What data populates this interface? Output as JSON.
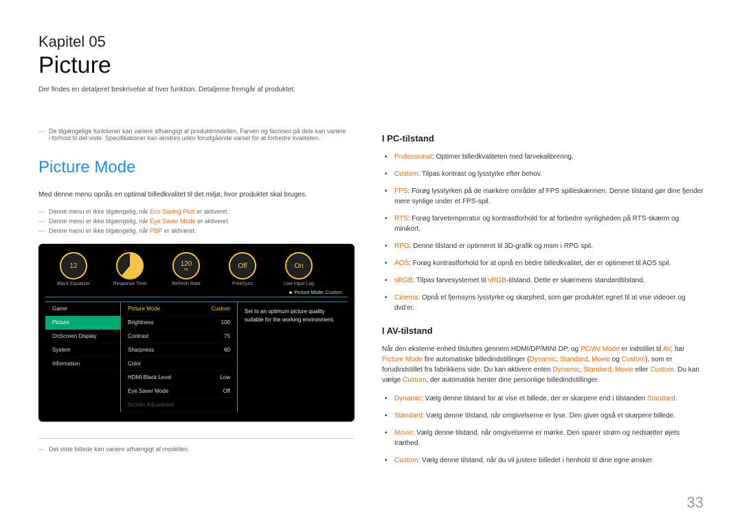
{
  "chapter": "Kapitel 05",
  "title": "Picture",
  "subtitle": "Der findes en detaljeret beskrivelse af hver funktion. Detaljerne fremgår af produktet.",
  "page_number": "33",
  "left": {
    "tip1a": "De tilgængelige funktioner kan variere afhængigt af produktmodellen. Farven og faconen på dele kan variere",
    "tip1b": "i forhold til det viste. Specifikationer kan ændres uden forudgående varsel for at forbedre kvaliteten.",
    "section_heading": "Picture Mode",
    "intro": "Med denne menu opnås en optimal billedkvalitet til det miljø, hvor produktet skal bruges.",
    "tip2_pre": "Denne menu er ikke tilgængelig, når ",
    "tip2_k": "Eco Saving Plus",
    "tip2_post": " er aktiveret.",
    "tip3_pre": "Denne menu er ikke tilgængelig, når ",
    "tip3_k": "Eye Saver Mode",
    "tip3_post": " er aktiveret.",
    "tip4_pre": "Denne menu er ikke tilgængelig, når ",
    "tip4_k": "PBP",
    "tip4_post": " er aktiveret.",
    "footnote": "Det viste billede kan variere afhængigt af modellen."
  },
  "osd": {
    "gauges": [
      {
        "value": "12",
        "sub": "",
        "label": "Black Equalizer"
      },
      {
        "value": "",
        "sub": "",
        "label": "Response Time"
      },
      {
        "value": "120",
        "sub": "Hz",
        "label": "Refresh Rate"
      },
      {
        "value": "Off",
        "sub": "",
        "label": "FreeSync"
      },
      {
        "value": "On",
        "sub": "",
        "label": "Low Input Lag"
      }
    ],
    "mode_label": "Picture Mode:",
    "mode_value": "Custom",
    "nav": [
      "Game",
      "Picture",
      "OnScreen Display",
      "System",
      "Information"
    ],
    "nav_selected": 1,
    "settings": [
      {
        "name": "Picture Mode",
        "value": "Custom",
        "hl": true
      },
      {
        "name": "Brightness",
        "value": "100"
      },
      {
        "name": "Contrast",
        "value": "75"
      },
      {
        "name": "Sharpness",
        "value": "60"
      },
      {
        "name": "Color",
        "value": ""
      },
      {
        "name": "HDMI Black Level",
        "value": "Low"
      },
      {
        "name": "Eye Saver Mode",
        "value": "Off"
      },
      {
        "name": "Screen Adjustment",
        "value": "",
        "dim": true
      }
    ],
    "desc": "Set to an optimum picture quality suitable for the working environment."
  },
  "right": {
    "pc_heading": "I PC-tilstand",
    "pc": [
      {
        "k": "Professional",
        "t": ": Optimer billedkvaliteten med farvekalibrering."
      },
      {
        "k": "Custom",
        "t": ": Tilpas kontrast og lysstyrke efter behov."
      },
      {
        "k": "FPS",
        "t": ": Forøg lysstyrken på de mørkere områder af FPS spilleskærmen. Denne tilstand gør dine fjender mere synlige under et FPS-spil."
      },
      {
        "k": "RTS",
        "t": ": Forøg farvetemperatur og kontrastforhold for at forbedre synligheden på RTS-skærm og minikort."
      },
      {
        "k": "RPG",
        "t": ": Denne tilstand er optimeret til 3D-grafik og msm i RPG spil."
      },
      {
        "k": "AOS",
        "t": ": Forøg kontrastforhold for at opnå en bedre billedkvalitet, der er optimeret til AOS spil."
      },
      {
        "k": "sRGB",
        "t_pre": ": Tilpas farvesystemet til ",
        "k2": "sRGB",
        "t_post": "-tilstand. Dette er skærmens standardtilstand."
      },
      {
        "k": "Cinema",
        "t": ": Opnå et fjernsyns lysstyrke og skarphed, som gør produktet egnet til at vise videoer og dvd'er."
      }
    ],
    "av_heading": "I AV-tilstand",
    "av_para": {
      "p1": "Når den eksterne enhed tilsluttes gennem HDMI/DP/MINI DP, og ",
      "k1": "PC/AV Mode",
      "p2": " er indstillet til ",
      "k2": "AV",
      "p3": ", har ",
      "k3": "Picture Mode",
      "p4": " fire automatiske billedindstillinger (",
      "k4": "Dynamic",
      "c1": ", ",
      "k5": "Standard",
      "c2": ", ",
      "k6": "Movie",
      "p5": " og ",
      "k7": "Custom",
      "p6": "), som er forudindstillet fra fabrikkens side. Du kan aktivere enten ",
      "k8": "Dynamic",
      "c3": ", ",
      "k9": "Standard",
      "c4": ", ",
      "k10": "Movie",
      "p7": " eller ",
      "k11": "Custom",
      "p8": ". Du kan vælge ",
      "k12": "Custom",
      "p9": ", der automatisk henter dine personlige billedindstillinger."
    },
    "av": [
      {
        "k": "Dynamic",
        "t_pre": ": Vælg denne tilstand for at vise et billede, der er skarpere end i tilstanden ",
        "k2": "Standard",
        "t_post": "."
      },
      {
        "k": "Standard",
        "t": ": Vælg denne tilstand, når omgivelserne er lyse. Den giver også et skarpere billede."
      },
      {
        "k": "Movie",
        "t": ": Vælg denne tilstand, når omgivelserne er mørke. Den sparer strøm og nedsætter øjets træthed."
      },
      {
        "k": "Custom",
        "t": ": Vælg denne tilstand, når du vil justere billedet i henhold til dine egne ønsker."
      }
    ]
  }
}
